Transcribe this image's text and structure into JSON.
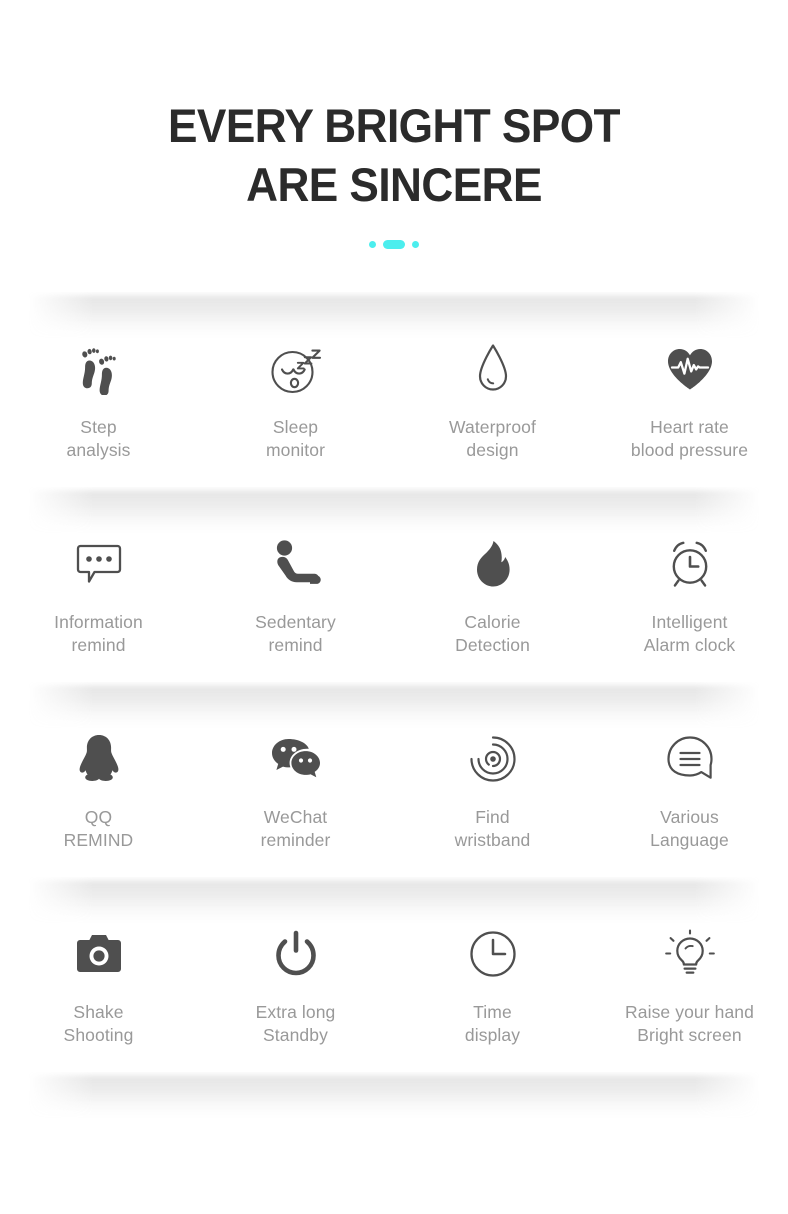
{
  "header": {
    "title_line1": "EVERY BRIGHT SPOT",
    "title_line2": "ARE SINCERE",
    "accent_color": "#4ceeee",
    "title_color": "#2b2b2b"
  },
  "styles": {
    "icon_color": "#4f4f4f",
    "label_color": "#999999",
    "background": "#ffffff"
  },
  "features": {
    "rows": [
      {
        "cells": [
          {
            "icon": "footprints-icon",
            "label": "Step\nanalysis"
          },
          {
            "icon": "sleeping-face-icon",
            "label": "Sleep\nmonitor"
          },
          {
            "icon": "water-drop-icon",
            "label": "Waterproof\ndesign"
          },
          {
            "icon": "heart-pulse-icon",
            "label": "Heart rate\nblood pressure"
          }
        ]
      },
      {
        "cells": [
          {
            "icon": "message-bubble-icon",
            "label": "Information\nremind"
          },
          {
            "icon": "seated-person-icon",
            "label": "Sedentary\nremind"
          },
          {
            "icon": "flame-icon",
            "label": "Calorie\nDetection"
          },
          {
            "icon": "alarm-clock-icon",
            "label": "Intelligent\nAlarm clock"
          }
        ]
      },
      {
        "cells": [
          {
            "icon": "qq-penguin-icon",
            "label": "QQ\nREMIND"
          },
          {
            "icon": "wechat-bubbles-icon",
            "label": "WeChat\nreminder"
          },
          {
            "icon": "radar-find-icon",
            "label": "Find\nwristband"
          },
          {
            "icon": "language-bubble-icon",
            "label": "Various\nLanguage"
          }
        ]
      },
      {
        "cells": [
          {
            "icon": "camera-icon",
            "label": "Shake\nShooting"
          },
          {
            "icon": "power-icon",
            "label": "Extra long\nStandby"
          },
          {
            "icon": "clock-icon",
            "label": "Time\ndisplay"
          },
          {
            "icon": "lightbulb-icon",
            "label": "Raise your hand\nBright screen"
          }
        ]
      }
    ]
  }
}
